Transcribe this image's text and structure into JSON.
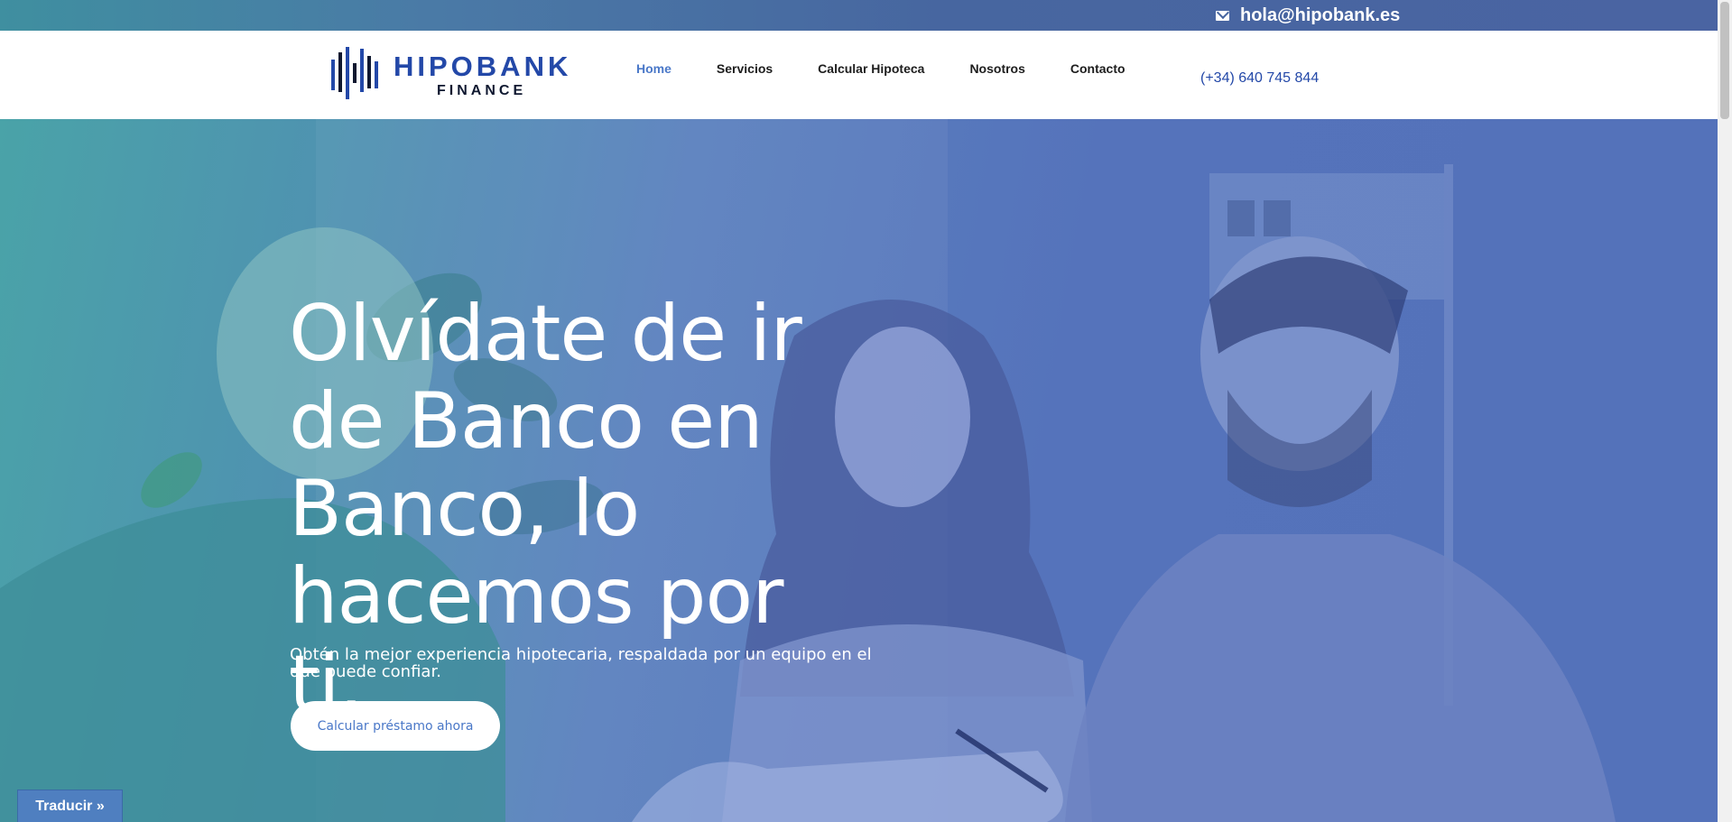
{
  "topbar": {
    "email": "hola@hipobank.es",
    "icon": "envelope-icon"
  },
  "header": {
    "logo": {
      "word": "HIPOBANK",
      "sub": "FINANCE"
    },
    "nav": [
      {
        "label": "Home",
        "active": true
      },
      {
        "label": "Servicios",
        "active": false
      },
      {
        "label": "Calcular Hipoteca",
        "active": false
      },
      {
        "label": "Nosotros",
        "active": false
      },
      {
        "label": "Contacto",
        "active": false
      }
    ],
    "phone": "(+34) 640 745 844"
  },
  "hero": {
    "headline": "Olvídate de ir de Banco en Banco, lo hacemos por ti.",
    "subtext": "Obtén la mejor experiencia hipotecaria, respaldada por un equipo en el que puede confiar.",
    "cta": "Calcular préstamo ahora"
  },
  "translate": {
    "label": "Traducir »"
  },
  "colors": {
    "brand_blue": "#2348a8",
    "nav_active": "#4a78c8",
    "overlay_blue": "#5472ba",
    "overlay_teal": "#4aa3a8"
  }
}
